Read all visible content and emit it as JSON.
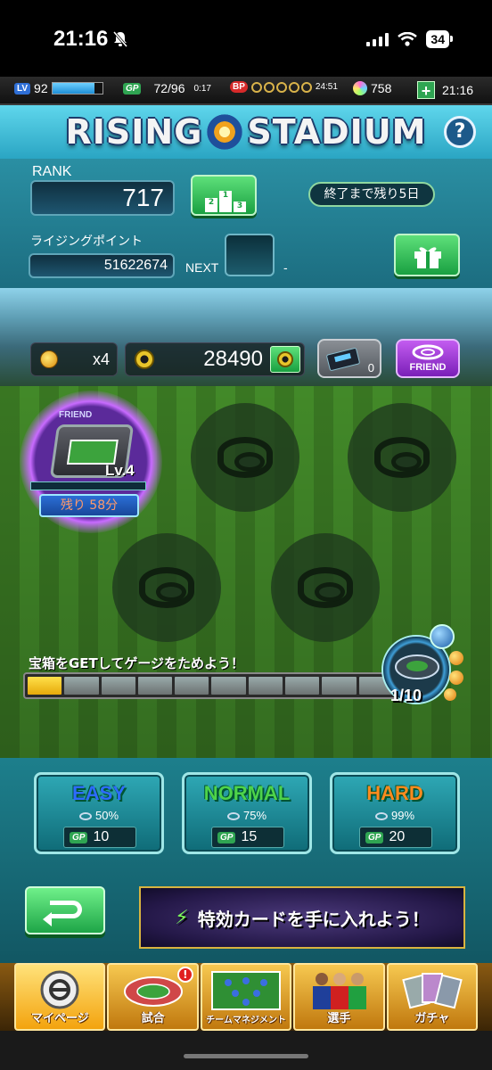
{
  "ios": {
    "time": "21:16",
    "battery": "34"
  },
  "status_bar": {
    "lv_badge": "LV",
    "level": "92",
    "exp_fraction": 0.85,
    "gp_badge": "GP",
    "gp": "72/96",
    "gp_timer": "0:17",
    "bp_badge": "BP",
    "bp_timer": "24:51",
    "gems": "758",
    "clock": "21:16",
    "plus": "+"
  },
  "header": {
    "title_left": "RISING",
    "title_right": "STADIUM",
    "help": "?"
  },
  "rank": {
    "label": "RANK",
    "value": "717",
    "ends_in": "終了まで残り5日",
    "points_label": "ライジングポイント",
    "points_value": "51622674",
    "next_label": "NEXT",
    "next_value": "-",
    "podium": [
      "2",
      "1",
      "3"
    ]
  },
  "resources": {
    "ball_count": "x4",
    "gear_count": "28490",
    "ticket_count": "0",
    "friend_label": "FRIEND"
  },
  "stadium": {
    "level": "Lv.4",
    "timer": "残り 58分",
    "card_label": "FRIEND"
  },
  "gauge": {
    "label": "宝箱をGETしてゲージをためよう！",
    "filled": 1,
    "total": 10,
    "count_text": "1/10"
  },
  "difficulties": [
    {
      "name": "EASY",
      "rate": "50%",
      "cost": "10",
      "color": "#2d6bff"
    },
    {
      "name": "NORMAL",
      "rate": "75%",
      "cost": "15",
      "color": "#4ed34a"
    },
    {
      "name": "HARD",
      "rate": "99%",
      "cost": "20",
      "color": "#ff8a1e"
    }
  ],
  "banner": {
    "text": "特効カードを手に入れよう！"
  },
  "nav": [
    {
      "label": "マイページ"
    },
    {
      "label": "試合",
      "notif": "!"
    },
    {
      "label": "チームマネジメント"
    },
    {
      "label": "選手"
    },
    {
      "label": "ガチャ"
    }
  ]
}
